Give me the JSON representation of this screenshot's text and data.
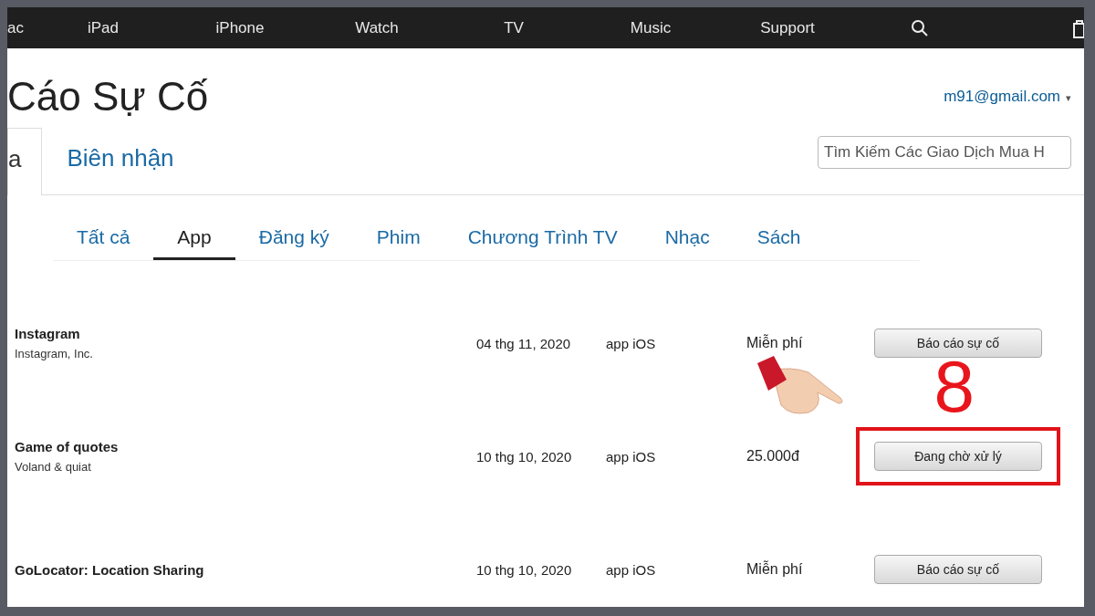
{
  "nav": {
    "items": [
      "ac",
      "iPad",
      "iPhone",
      "Watch",
      "TV",
      "Music",
      "Support"
    ]
  },
  "header": {
    "title": "Cáo Sự Cố",
    "account": "m91@gmail.com",
    "account_caret": "▾"
  },
  "account_tabs": [
    {
      "label": "a",
      "selected": true
    },
    {
      "label": "Biên nhận",
      "selected": false
    }
  ],
  "search": {
    "placeholder": "Tìm Kiếm Các Giao Dịch Mua H"
  },
  "category_tabs": [
    {
      "label": "Tất cả",
      "selected": false
    },
    {
      "label": "App",
      "selected": true
    },
    {
      "label": "Đăng ký",
      "selected": false
    },
    {
      "label": "Phim",
      "selected": false
    },
    {
      "label": "Chương Trình TV",
      "selected": false
    },
    {
      "label": "Nhạc",
      "selected": false
    },
    {
      "label": "Sách",
      "selected": false
    }
  ],
  "rows": [
    {
      "name": "Instagram",
      "developer": "Instagram, Inc.",
      "date": "04 thg 11, 2020",
      "type": "app iOS",
      "price": "Miễn phí",
      "button": "Báo cáo sự cố",
      "highlighted": false
    },
    {
      "name": "Game of quotes",
      "developer": "Voland & quiat",
      "date": "10 thg 10, 2020",
      "type": "app iOS",
      "price": "25.000đ",
      "button": "Đang chờ xử lý",
      "highlighted": true
    },
    {
      "name": "GoLocator: Location Sharing",
      "date": "10 thg 10, 2020",
      "type": "app iOS",
      "price": "Miễn phí",
      "button": "Báo cáo sự cố",
      "highlighted": false
    }
  ],
  "annotation": {
    "step_number": "8"
  }
}
